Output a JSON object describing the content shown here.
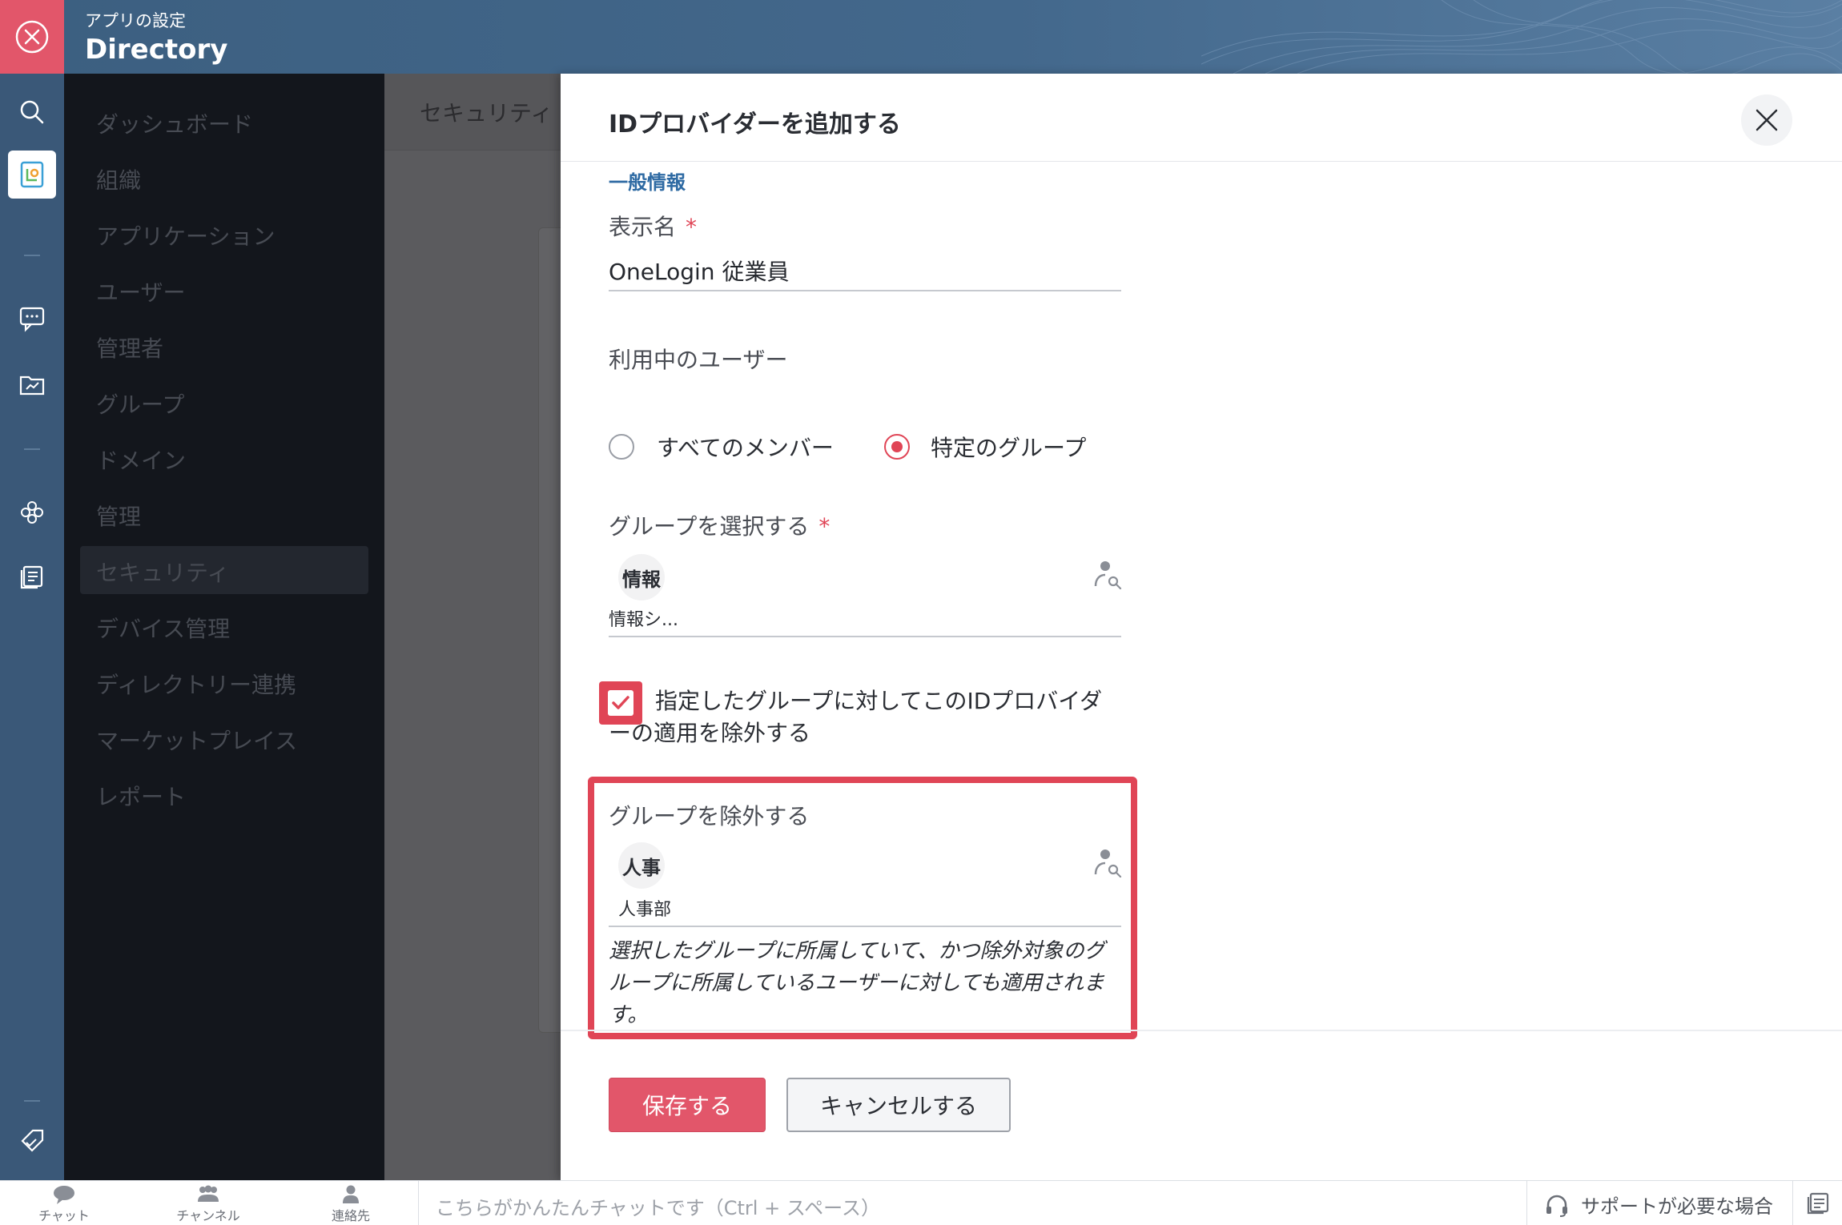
{
  "header": {
    "subtitle": "アプリの設定",
    "title": "Directory"
  },
  "sidebar": {
    "items": [
      {
        "label": "ダッシュボード"
      },
      {
        "label": "組織"
      },
      {
        "label": "アプリケーション"
      },
      {
        "label": "ユーザー"
      },
      {
        "label": "管理者"
      },
      {
        "label": "グループ"
      },
      {
        "label": "ドメイン"
      },
      {
        "label": "管理"
      },
      {
        "label": "セキュリティ"
      },
      {
        "label": "デバイス管理"
      },
      {
        "label": "ディレクトリー連携"
      },
      {
        "label": "マーケットプレイス"
      },
      {
        "label": "レポート"
      }
    ],
    "active": "セキュリティ"
  },
  "main": {
    "breadcrumb": "セキュリティ"
  },
  "drawer": {
    "title": "IDプロバイダーを追加する",
    "section": "一般情報",
    "display_name": {
      "label": "表示名",
      "required_mark": "*",
      "value": "OneLogin 従業員"
    },
    "users": {
      "label": "利用中のユーザー",
      "options": [
        {
          "label": "すべてのメンバー",
          "selected": false
        },
        {
          "label": "特定のグループ",
          "selected": true
        }
      ]
    },
    "select_group": {
      "label": "グループを選択する",
      "required_mark": "*",
      "chip": "情報",
      "chip_sub": "情報シ..."
    },
    "exclude_checkbox": {
      "checked": true,
      "label": "指定したグループに対してこのIDプロバイダーの適用を除外する"
    },
    "exclude_group": {
      "label": "グループを除外する",
      "chip": "人事",
      "chip_sub": "人事部",
      "note": "選択したグループに所属していて、かつ除外対象のグループに所属しているユーザーに対しても適用されます。"
    },
    "buttons": {
      "save": "保存する",
      "cancel": "キャンセルする"
    }
  },
  "bottombar": {
    "chat": "チャット",
    "channel": "チャンネル",
    "contacts": "連絡先",
    "chat_placeholder": "こちらがかんたんチャットです（Ctrl + スペース）",
    "support": "サポートが必要な場合"
  },
  "colors": {
    "accent": "#e2566a",
    "header": "#3c5f80",
    "link": "#2e6aa3"
  }
}
